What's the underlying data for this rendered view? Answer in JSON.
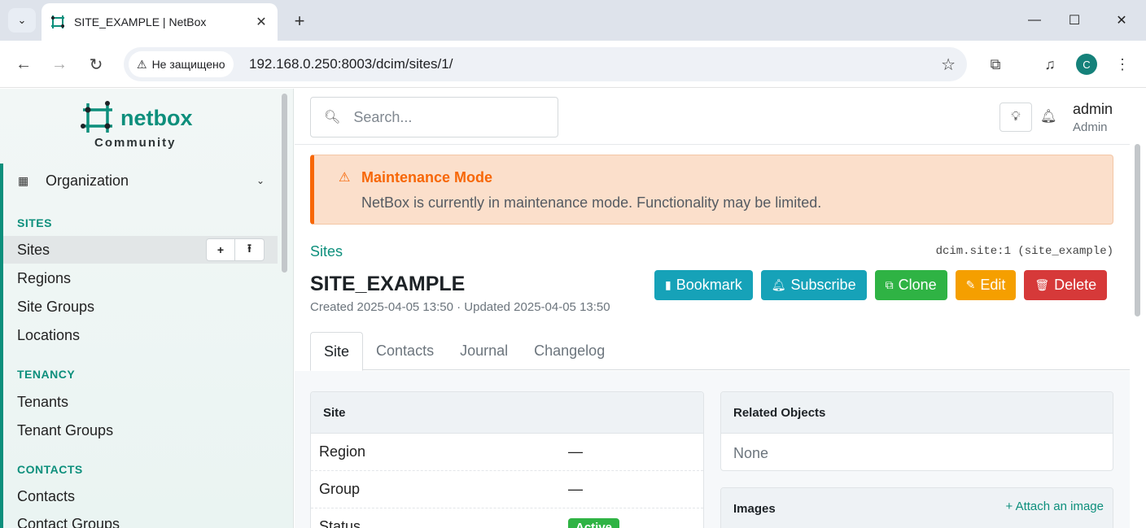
{
  "browser": {
    "tab_title": "SITE_EXAMPLE | NetBox",
    "security_label": "Не защищено",
    "url": "192.168.0.250:8003/dcim/sites/1/",
    "profile_initial": "C"
  },
  "sidebar": {
    "brand_name": "netbox",
    "brand_edition": "Community",
    "menu_group": "Organization",
    "sections": [
      {
        "header": "SITES",
        "items": [
          "Sites",
          "Regions",
          "Site Groups",
          "Locations"
        ]
      },
      {
        "header": "TENANCY",
        "items": [
          "Tenants",
          "Tenant Groups"
        ]
      },
      {
        "header": "CONTACTS",
        "items": [
          "Contacts",
          "Contact Groups"
        ]
      }
    ],
    "active_item": "Sites"
  },
  "header": {
    "search_placeholder": "Search...",
    "user_name": "admin",
    "user_role": "Admin"
  },
  "alert": {
    "title": "Maintenance Mode",
    "message": "NetBox is currently in maintenance mode. Functionality may be limited."
  },
  "page": {
    "breadcrumb": "Sites",
    "object_id": "dcim.site:1 (site_example)",
    "title": "SITE_EXAMPLE",
    "meta": "Created 2025-04-05 13:50 · Updated 2025-04-05 13:50",
    "actions": {
      "bookmark": "Bookmark",
      "subscribe": "Subscribe",
      "clone": "Clone",
      "edit": "Edit",
      "delete": "Delete"
    },
    "tabs": [
      "Site",
      "Contacts",
      "Journal",
      "Changelog"
    ]
  },
  "site_card": {
    "title": "Site",
    "rows": [
      {
        "key": "Region",
        "value": "—"
      },
      {
        "key": "Group",
        "value": "—"
      },
      {
        "key": "Status",
        "value": "Active"
      }
    ]
  },
  "related_card": {
    "title": "Related Objects",
    "empty": "None"
  },
  "images_card": {
    "title": "Images",
    "attach": "Attach an image"
  },
  "colors": {
    "brand": "#0d8f7c",
    "alert": "#f76707",
    "info": "#16a2b8",
    "success": "#2fb344",
    "warning": "#f59f00",
    "danger": "#d63939"
  }
}
